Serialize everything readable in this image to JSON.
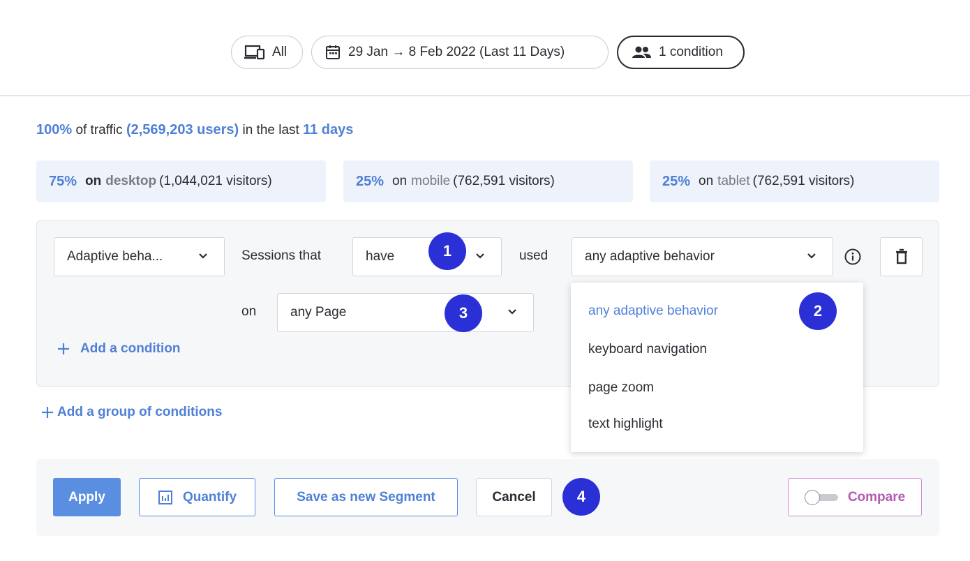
{
  "filters": {
    "device_label": "All",
    "date_range": "29 Jan → 8 Feb 2022 (Last 11 Days)",
    "condition_label": "1 condition"
  },
  "traffic": {
    "percent": "100%",
    "of_traffic": "of traffic",
    "users": "(2,569,203 users)",
    "in_last": "in the last",
    "days": "11 days"
  },
  "devices": [
    {
      "percent": "75%",
      "on": "on",
      "device": "desktop",
      "visitors": "(1,044,021 visitors)"
    },
    {
      "percent": "25%",
      "on": "on",
      "device": "mobile",
      "visitors": "(762,591 visitors)"
    },
    {
      "percent": "25%",
      "on": "on",
      "device": "tablet",
      "visitors": "(762,591 visitors)"
    }
  ],
  "condition": {
    "category": "Adaptive beha...",
    "sessions_that": "Sessions that",
    "verb": "have",
    "used": "used",
    "behavior": "any adaptive behavior",
    "on": "on",
    "page": "any Page",
    "add_condition": "Add a condition"
  },
  "add_group": "Add a group of conditions",
  "dropdown": {
    "items": [
      "any adaptive behavior",
      "keyboard navigation",
      "page zoom",
      "text highlight"
    ],
    "selected_index": 0
  },
  "footer": {
    "apply": "Apply",
    "quantify": "Quantify",
    "save_segment": "Save as new Segment",
    "cancel": "Cancel",
    "compare": "Compare"
  },
  "markers": [
    "1",
    "2",
    "3",
    "4"
  ],
  "colors": {
    "accent_blue": "#4f7fd6",
    "primary_button": "#5a8ee0",
    "marker": "#2a30d6",
    "compare": "#b45ab0"
  }
}
